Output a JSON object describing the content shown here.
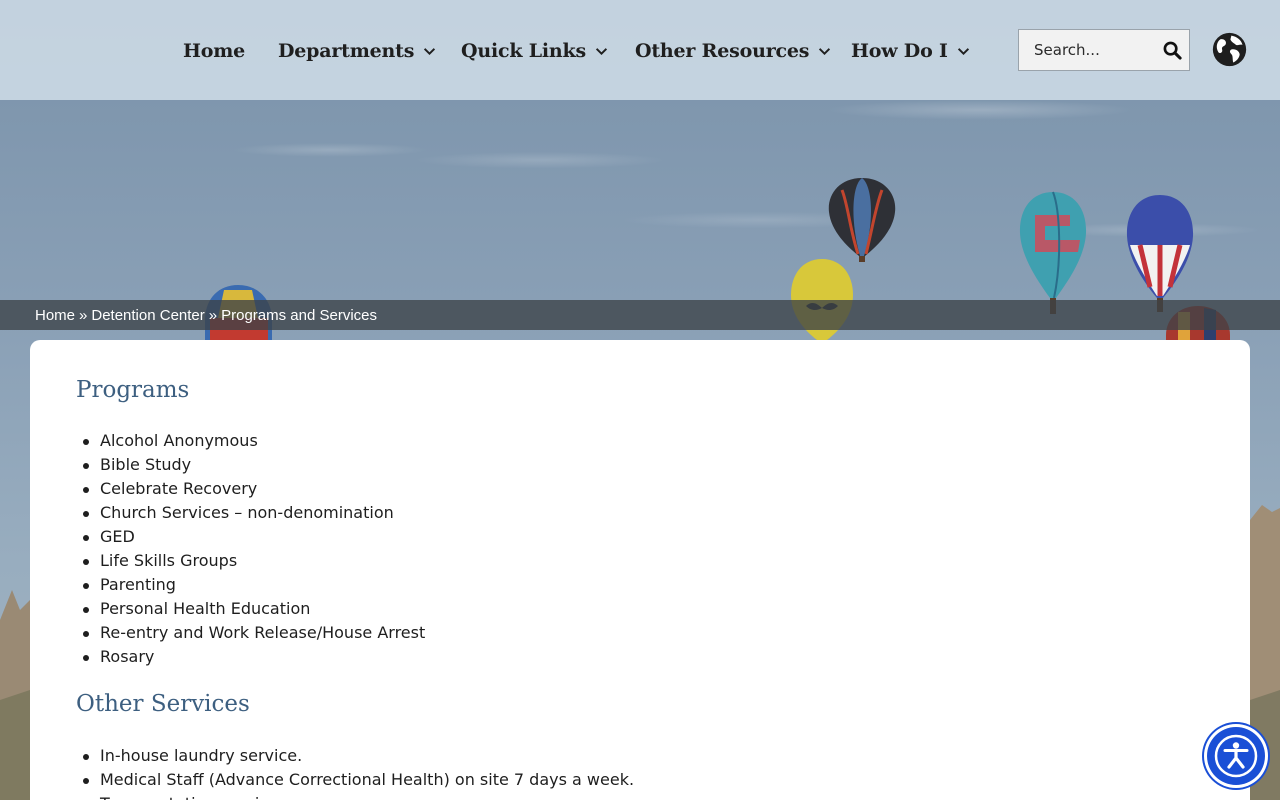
{
  "nav": {
    "items": [
      {
        "label": "Home",
        "has_dropdown": false
      },
      {
        "label": "Departments",
        "has_dropdown": true
      },
      {
        "label": "Quick Links",
        "has_dropdown": true
      },
      {
        "label": "Other Resources",
        "has_dropdown": true
      },
      {
        "label": "How Do I",
        "has_dropdown": true
      }
    ],
    "search": {
      "placeholder": "Search...",
      "value": "",
      "icon": "search-icon"
    },
    "language_icon": "globe-icon"
  },
  "breadcrumb": {
    "items": [
      "Home",
      "Detention Center",
      "Programs and Services"
    ],
    "separator": "»"
  },
  "content": {
    "programs": {
      "title": "Programs",
      "items": [
        "Alcohol Anonymous",
        "Bible Study",
        "Celebrate Recovery",
        "Church Services – non-denomination",
        "GED",
        "Life Skills Groups",
        "Parenting",
        "Personal Health Education",
        "Re-entry and Work Release/House Arrest",
        "Rosary"
      ]
    },
    "other_services": {
      "title": "Other Services",
      "items": [
        "In-house laundry service.",
        "Medical Staff (Advance Correctional Health) on site 7 days a week.",
        "Transportation services."
      ]
    }
  },
  "accessibility_button": {
    "icon": "accessibility-icon"
  },
  "colors": {
    "heading": "#3d5f80",
    "header_bg": "#d6e2ec",
    "breadcrumb_bg": "#3c4248",
    "accessibility": "#1a4fd6"
  }
}
